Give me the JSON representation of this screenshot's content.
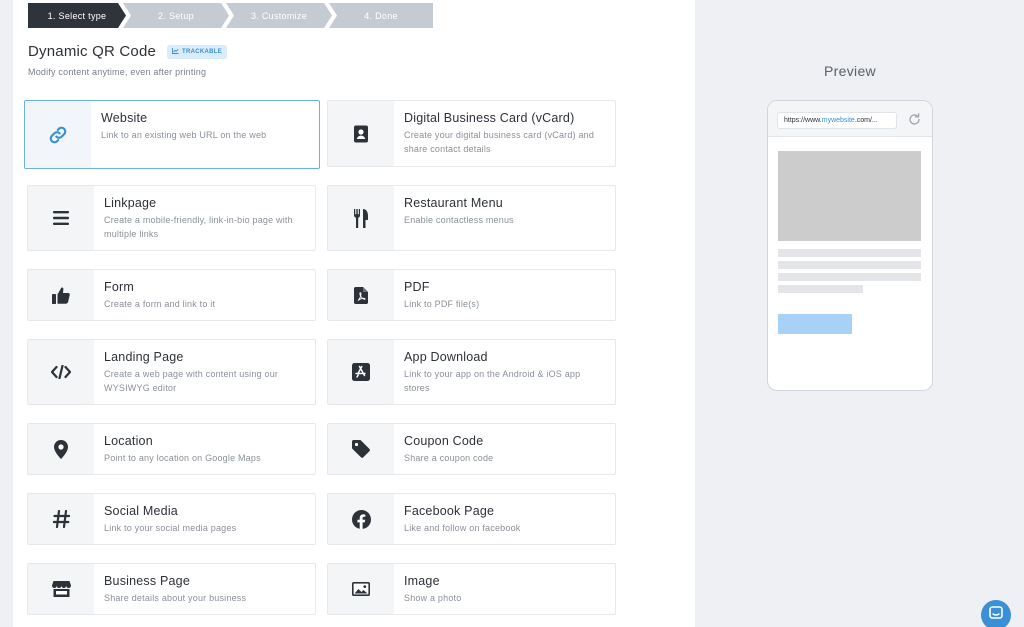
{
  "stepper": [
    {
      "label": "1. Select type",
      "active": true
    },
    {
      "label": "2. Setup",
      "active": false
    },
    {
      "label": "3. Customize",
      "active": false
    },
    {
      "label": "4. Done",
      "active": false
    }
  ],
  "header": {
    "title": "Dynamic QR Code",
    "badge": "TRACKABLE",
    "subtitle": "Modify content anytime, even after printing"
  },
  "types": [
    {
      "name": "Website",
      "desc": "Link to an existing web URL on the web",
      "icon": "link-icon",
      "selected": true
    },
    {
      "name": "Digital Business Card (vCard)",
      "desc": "Create your digital business card (vCard) and share contact details",
      "icon": "contact-card-icon"
    },
    {
      "name": "Linkpage",
      "desc": "Create a mobile-friendly, link-in-bio page with multiple links",
      "icon": "menu-lines-icon"
    },
    {
      "name": "Restaurant Menu",
      "desc": "Enable contactless menus",
      "icon": "fork-knife-icon"
    },
    {
      "name": "Form",
      "desc": "Create a form and link to it",
      "icon": "thumbs-up-icon"
    },
    {
      "name": "PDF",
      "desc": "Link to PDF file(s)",
      "icon": "pdf-file-icon"
    },
    {
      "name": "Landing Page",
      "desc": "Create a web page with content using our WYSIWYG editor",
      "icon": "code-icon"
    },
    {
      "name": "App Download",
      "desc": "Link to your app on the Android & iOS app stores",
      "icon": "app-store-icon"
    },
    {
      "name": "Location",
      "desc": "Point to any location on Google Maps",
      "icon": "map-pin-icon"
    },
    {
      "name": "Coupon Code",
      "desc": "Share a coupon code",
      "icon": "tag-icon"
    },
    {
      "name": "Social Media",
      "desc": "Link to your social media pages",
      "icon": "hashtag-icon"
    },
    {
      "name": "Facebook Page",
      "desc": "Like and follow on facebook",
      "icon": "facebook-icon"
    },
    {
      "name": "Business Page",
      "desc": "Share details about your business",
      "icon": "storefront-icon"
    },
    {
      "name": "Image",
      "desc": "Show a photo",
      "icon": "image-icon"
    }
  ],
  "preview": {
    "label": "Preview",
    "url_prefix": "https://www.",
    "url_highlight": "mywebsite",
    "url_suffix": ".com/..."
  },
  "colors": {
    "accent": "#3a8fd6",
    "active_step": "#2f333b",
    "inactive_step": "#c5cbd3",
    "selected_border": "#6aaef0"
  }
}
